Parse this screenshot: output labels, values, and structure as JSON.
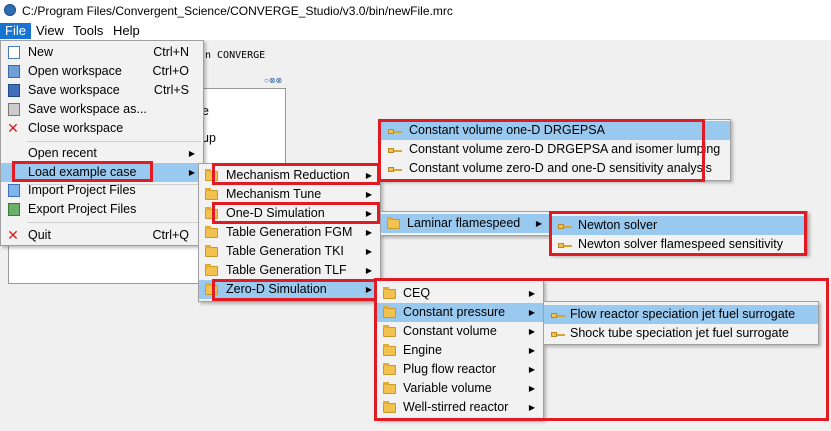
{
  "window": {
    "title": "C:/Program Files/Convergent_Science/CONVERGE_Studio/v3.0/bin/newFile.mrc"
  },
  "menubar": {
    "items": [
      "File",
      "View",
      "Tools",
      "Help"
    ]
  },
  "background": {
    "toolbar_text": "n CONVERGE",
    "panel_fragments": [
      "e",
      "up"
    ],
    "panel_controls": "○⊗⊗"
  },
  "file_menu": {
    "items": [
      {
        "label": "New",
        "shortcut": "Ctrl+N",
        "icon": "new-file-icon"
      },
      {
        "label": "Open workspace",
        "shortcut": "Ctrl+O",
        "icon": "open-workspace-icon"
      },
      {
        "label": "Save workspace",
        "shortcut": "Ctrl+S",
        "icon": "save-icon"
      },
      {
        "label": "Save workspace as...",
        "shortcut": "",
        "icon": "save-as-icon"
      },
      {
        "label": "Close workspace",
        "shortcut": "",
        "icon": "close-icon"
      },
      {
        "label": "Open recent",
        "shortcut": "",
        "icon": ""
      },
      {
        "label": "Load example case",
        "shortcut": "",
        "icon": ""
      },
      {
        "label": "Import Project Files",
        "shortcut": "",
        "icon": "import-icon"
      },
      {
        "label": "Export Project Files",
        "shortcut": "",
        "icon": "export-icon"
      },
      {
        "label": "Quit",
        "shortcut": "Ctrl+Q",
        "icon": "quit-icon"
      }
    ]
  },
  "example_menu": {
    "items": [
      "Mechanism Reduction",
      "Mechanism Tune",
      "One-D Simulation",
      "Table Generation FGM",
      "Table Generation TKI",
      "Table Generation TLF",
      "Zero-D Simulation"
    ]
  },
  "mechanism_reduction_menu": {
    "items": [
      "Constant volume one-D DRGEPSA",
      "Constant volume zero-D DRGEPSA and isomer lumping",
      "Constant volume zero-D and one-D sensitivity analysis"
    ]
  },
  "one_d_menu": {
    "items": [
      "Laminar flamespeed"
    ]
  },
  "laminar_menu": {
    "items": [
      "Newton solver",
      "Newton solver flamespeed sensitivity"
    ]
  },
  "zero_d_menu": {
    "items": [
      "CEQ",
      "Constant pressure",
      "Constant volume",
      "Engine",
      "Plug flow reactor",
      "Variable volume",
      "Well-stirred reactor"
    ]
  },
  "constant_pressure_menu": {
    "items": [
      "Flow reactor speciation jet fuel surrogate",
      "Shock tube speciation jet fuel surrogate"
    ]
  },
  "colors": {
    "highlight": "#99c9ef",
    "menubar_active": "#1874d2",
    "annotation_red": "#e01b24"
  }
}
